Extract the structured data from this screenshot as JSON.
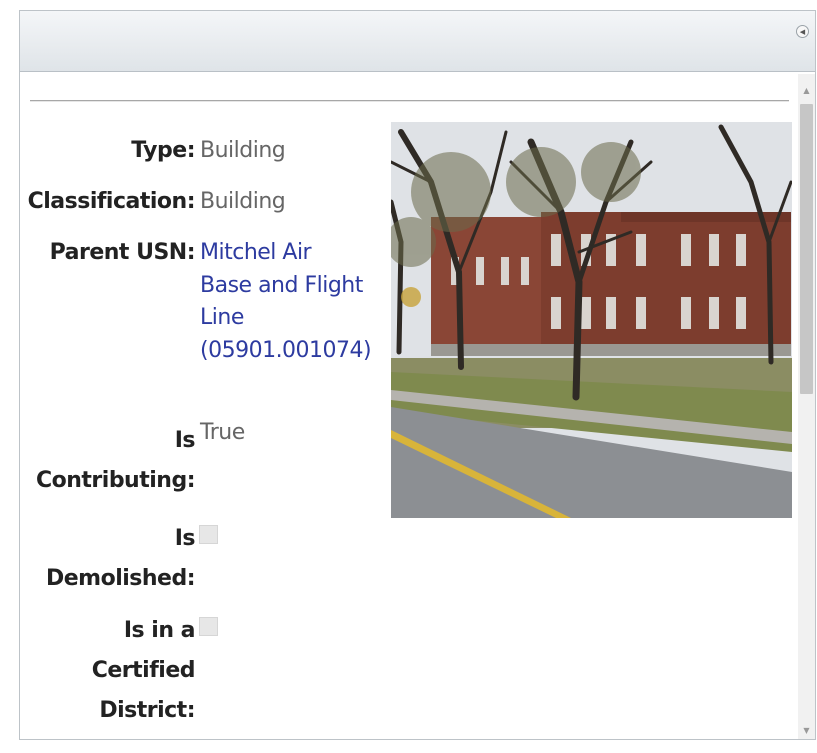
{
  "panel": {
    "collapse_icon": "collapse-left-icon"
  },
  "details": {
    "type_label": "Type:",
    "type_value": "Building",
    "classification_label": "Classification:",
    "classification_value": "Building",
    "parent_usn_label": "Parent USN:",
    "parent_usn_lines": [
      "Mitchel Air",
      "Base and Flight",
      "Line",
      "(05901.001074)"
    ],
    "contributing_label_lines": [
      "Is",
      "Contributing:"
    ],
    "contributing_value": "True",
    "demolished_label_lines": [
      "Is",
      "Demolished:"
    ],
    "demolished_checked": false,
    "certified_label_lines": [
      "Is in a",
      "Certified",
      "District:"
    ],
    "certified_checked": false
  },
  "photo": {
    "subject": "brick-building-photo",
    "sky": "#dfe2e6",
    "brick": "#8a4636",
    "grass": "#7f8a4e",
    "road": "#8c8f93"
  },
  "colors": {
    "link": "#2d3ba0",
    "value": "#666666",
    "label": "#222222"
  }
}
